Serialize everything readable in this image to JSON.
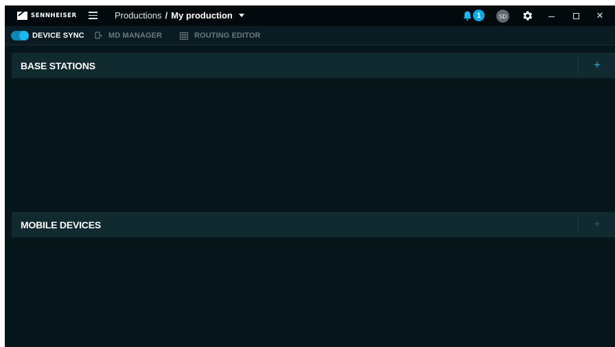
{
  "brand": {
    "name": "SENNHEISER"
  },
  "header": {
    "breadcrumb_root": "Productions",
    "breadcrumb_sep": "/",
    "breadcrumb_current": "My production",
    "notifications_count": "1",
    "avatar_initials": "SD",
    "close_glyph": "✕"
  },
  "toolbar": {
    "device_sync": {
      "label": "DEVICE SYNC",
      "enabled": true
    },
    "md_manager": {
      "label": "MD MANAGER"
    },
    "routing_editor": {
      "label": "ROUTING EDITOR"
    }
  },
  "sections": {
    "base_stations": {
      "title": "BASE STATIONS",
      "add_glyph": "+"
    },
    "mobile_devices": {
      "title": "MOBILE DEVICES",
      "add_glyph": "+"
    }
  },
  "colors": {
    "accent": "#1db7f0",
    "background": "#07161b",
    "titlebar": "#030a0d",
    "section_header": "#102a30"
  }
}
